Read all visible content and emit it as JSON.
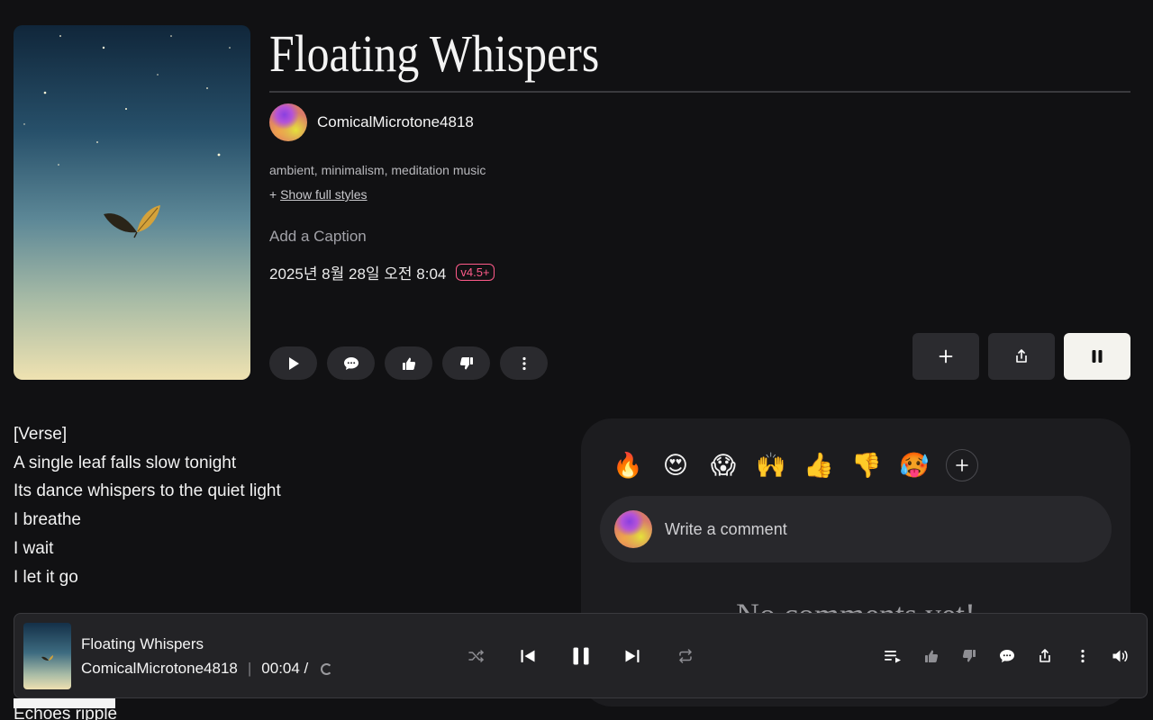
{
  "song": {
    "title": "Floating Whispers",
    "artist": "ComicalMicrotone4818",
    "tags": "ambient, minimalism, meditation music",
    "show_prefix": "+ ",
    "show_styles": "Show full styles",
    "caption_placeholder": "Add a Caption",
    "date": "2025년 8월 28일 오전 8:04",
    "version": "v4.5+"
  },
  "icons": {
    "play": "play-icon",
    "comment": "comment-icon",
    "like": "thumbs-up-icon",
    "dislike": "thumbs-down-icon",
    "more": "more-vertical-icon",
    "add": "plus-icon",
    "share": "share-icon",
    "pause": "pause-icon"
  },
  "lyrics": {
    "lines": [
      "[Verse]",
      "A single leaf falls slow tonight",
      "Its dance whispers to the quiet light",
      "I breathe",
      "I wait",
      "I let it go"
    ],
    "next_line": "Echoes ripple"
  },
  "comments": {
    "reactions": [
      "🔥",
      "😍",
      "😱",
      "🙌",
      "👍",
      "👎",
      "🥵"
    ],
    "placeholder": "Write a comment",
    "empty_text": "No comments yet!"
  },
  "player": {
    "title": "Floating Whispers",
    "artist": "ComicalMicrotone4818",
    "separator": "|",
    "time": "00:04 /",
    "progress_fraction": 0.09
  },
  "colors": {
    "background": "#111113",
    "accent_version": "#ff5b8a",
    "panel": "#1c1c1f"
  }
}
